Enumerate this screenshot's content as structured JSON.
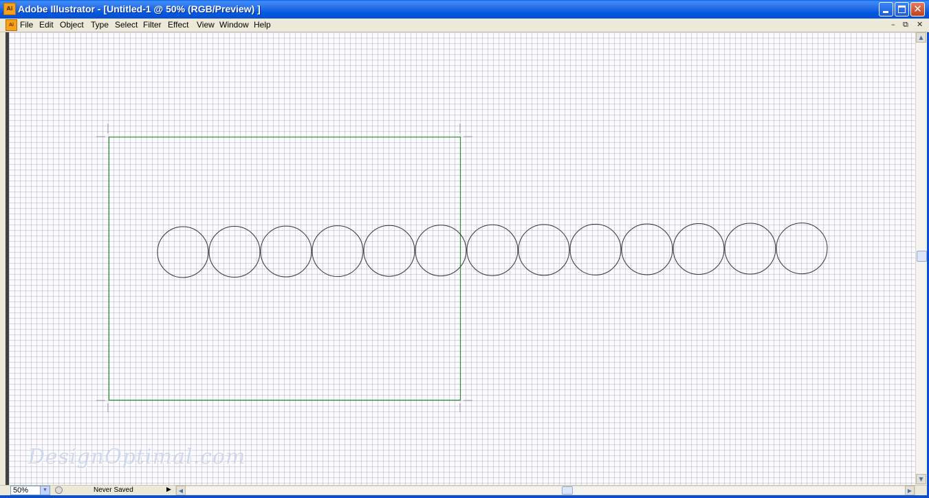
{
  "window": {
    "app_icon": "illustrator-app-icon",
    "app_icon_text": "Ai",
    "title": "Adobe Illustrator - [Untitled-1 @ 50% (RGB/Preview) ]",
    "controls": {
      "minimize": "minimize-icon",
      "maximize": "maximize-icon",
      "close": "✕"
    }
  },
  "menubar": {
    "items": [
      "File",
      "Edit",
      "Object",
      "Type",
      "Select",
      "Filter",
      "Effect",
      "View",
      "Window",
      "Help"
    ],
    "doc_controls": {
      "minimize": "–",
      "restore": "⧉",
      "close": "✕"
    }
  },
  "canvas": {
    "grid": true,
    "artboard_color": "#2e8b2e",
    "circle_count": 13,
    "circle_stroke": "#333333",
    "watermark": "DesignOptimal.com"
  },
  "statusbar": {
    "zoom": "50%",
    "status": "Never Saved"
  },
  "colors": {
    "titlebar": "#0a5fe8",
    "chrome": "#ece9d8",
    "grid_line": "#c9c3dd"
  }
}
